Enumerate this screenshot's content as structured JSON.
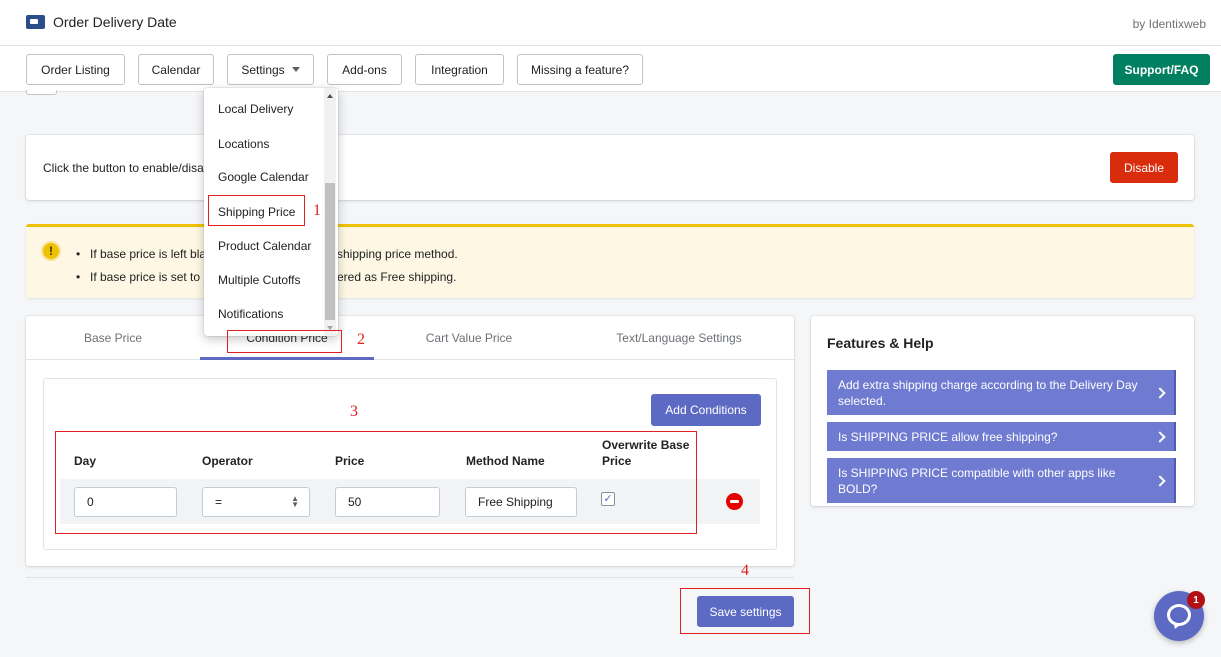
{
  "header": {
    "app_title": "Order Delivery Date",
    "byline": "by Identixweb"
  },
  "nav": {
    "order_listing": "Order Listing",
    "calendar": "Calendar",
    "settings": "Settings",
    "addons": "Add-ons",
    "integration": "Integration",
    "missing_feature": "Missing a feature?",
    "support": "Support/FAQ"
  },
  "settings_menu": {
    "items": [
      "Local Delivery",
      "Locations",
      "Google Calendar",
      "Shipping Price",
      "Product Calendar",
      "Multiple Cutoffs",
      "Notifications"
    ]
  },
  "enable_card": {
    "text": "Click the button to enable/disa",
    "disable_label": "Disable"
  },
  "banner": {
    "line1_start": "If base price is left bla",
    "line1_end": "shipping price method.",
    "line2_start": "If base price is set to z",
    "line2_end": "ered as Free shipping."
  },
  "tabs": [
    "Base Price",
    "Condition Price",
    "Cart Value Price",
    "Text/Language Settings"
  ],
  "conditions": {
    "add_label": "Add Conditions",
    "headers": {
      "day": "Day",
      "operator": "Operator",
      "price": "Price",
      "method": "Method Name",
      "overwrite_line1": "Overwrite Base",
      "overwrite_line2": "Price"
    },
    "row": {
      "day": "0",
      "operator": "=",
      "price": "50",
      "method": "Free Shipping",
      "overwrite": "✓"
    }
  },
  "save_label": "Save settings",
  "help": {
    "title": "Features & Help",
    "links": [
      {
        "line1": "Add extra shipping charge according to the Delivery Day",
        "line2": "selected."
      },
      {
        "line1": "Is SHIPPING PRICE allow free shipping?"
      },
      {
        "line1": "Is SHIPPING PRICE compatible with other apps like BOLD?"
      }
    ]
  },
  "annotations": [
    "1",
    "2",
    "3",
    "4"
  ],
  "chat_badge": "1",
  "colors": {
    "primary": "#5c6ac4",
    "support": "#008060",
    "danger": "#d82c0d",
    "annotation": "#e02020",
    "warning": "#eec200"
  }
}
